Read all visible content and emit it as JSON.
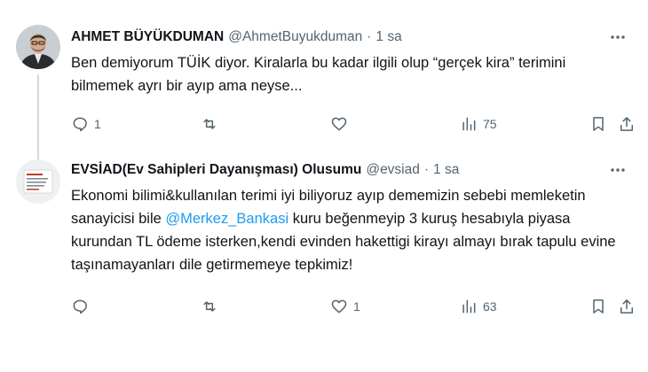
{
  "tweets": [
    {
      "author_name": "AHMET BÜYÜKDUMAN",
      "handle": "@AhmetBuyukduman",
      "separator": "·",
      "time": "1 sa",
      "text_parts": [
        "Ben demiyorum TÜİK diyor. Kiralarla bu kadar ilgili olup “gerçek kira” terimini bilmemek ayrı bir ayıp ama neyse..."
      ],
      "replies": "1",
      "reposts": "",
      "likes": "",
      "views": "75"
    },
    {
      "author_name": "EVSİAD(Ev Sahipleri Dayanışması) Olusumu",
      "handle": "@evsiad",
      "separator": "·",
      "time": "1 sa",
      "text_before": "Ekonomi bilimi&kullanılan terimi iyi biliyoruz ayıp dememizin sebebi memleketin sanayicisi bile ",
      "mention": "@Merkez_Bankasi",
      "text_after": " kuru beğenmeyip 3 kuruş hesabıyla piyasa kurundan TL  ödeme isterken,kendi evinden hakettigi kirayı almayı bırak tapulu evine taşınamayanları dile getirmemeye tepkimiz!",
      "replies": "",
      "reposts": "",
      "likes": "1",
      "views": "63"
    }
  ],
  "icons": {
    "more": "more-dots-icon",
    "reply": "reply-icon",
    "repost": "repost-icon",
    "like": "like-icon",
    "views": "views-icon",
    "bookmark": "bookmark-icon",
    "share": "share-icon"
  },
  "colors": {
    "text": "#0f1419",
    "secondary": "#536471",
    "mention": "#1d9bf0",
    "thread_line": "#cfd9de"
  }
}
